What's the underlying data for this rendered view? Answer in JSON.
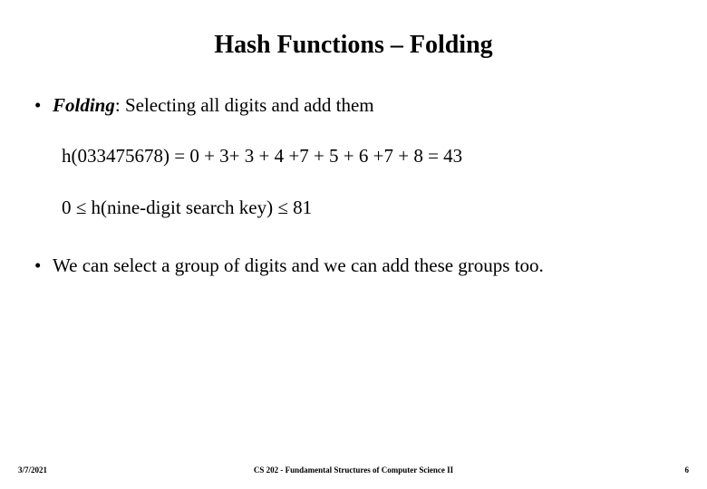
{
  "title": "Hash Functions – Folding",
  "bullet1_term": "Folding",
  "bullet1_rest": ": Selecting all digits and add them",
  "equation": "h(033475678) = 0 + 3+ 3 + 4 +7 + 5 + 6 +7 + 8 = 43",
  "range": "0 ≤ h(nine-digit search key) ≤ 81",
  "bullet2": "We can select a group of digits and we can add these groups too.",
  "footer": {
    "date": "3/7/2021",
    "course": "CS 202 - Fundamental Structures of Computer Science II",
    "page": "6"
  }
}
